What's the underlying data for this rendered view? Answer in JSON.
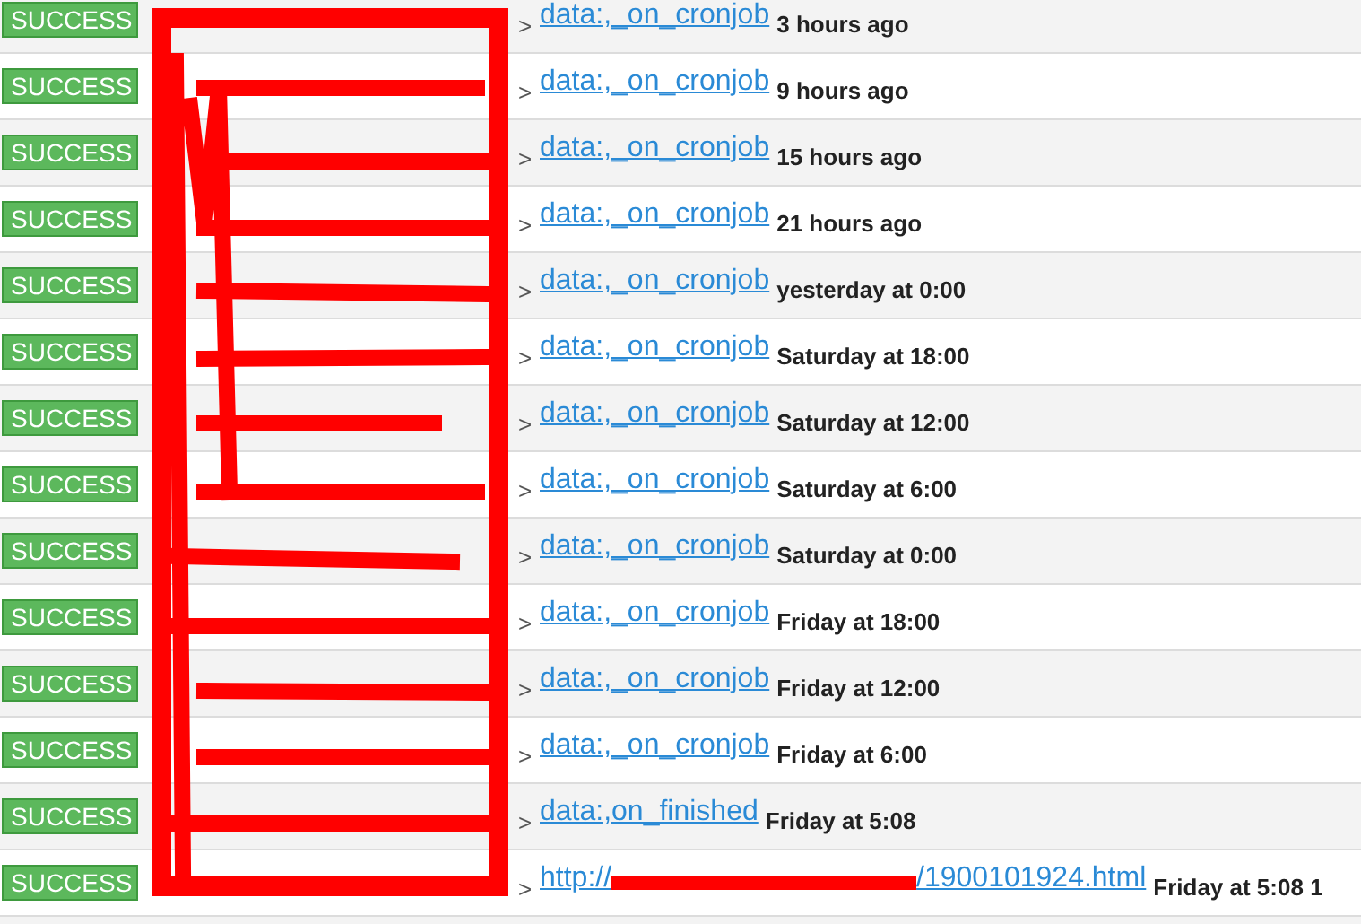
{
  "rows": [
    {
      "status": "SUCCESS",
      "link": {
        "kind": "text",
        "text": "data:,_on_cronjob"
      },
      "time": "3 hours ago"
    },
    {
      "status": "SUCCESS",
      "link": {
        "kind": "text",
        "text": "data:,_on_cronjob"
      },
      "time": "9 hours ago"
    },
    {
      "status": "SUCCESS",
      "link": {
        "kind": "text",
        "text": "data:,_on_cronjob"
      },
      "time": "15 hours ago"
    },
    {
      "status": "SUCCESS",
      "link": {
        "kind": "text",
        "text": "data:,_on_cronjob"
      },
      "time": "21 hours ago"
    },
    {
      "status": "SUCCESS",
      "link": {
        "kind": "text",
        "text": "data:,_on_cronjob"
      },
      "time": "yesterday at 0:00"
    },
    {
      "status": "SUCCESS",
      "link": {
        "kind": "text",
        "text": "data:,_on_cronjob"
      },
      "time": "Saturday at 18:00"
    },
    {
      "status": "SUCCESS",
      "link": {
        "kind": "text",
        "text": "data:,_on_cronjob"
      },
      "time": "Saturday at 12:00"
    },
    {
      "status": "SUCCESS",
      "link": {
        "kind": "text",
        "text": "data:,_on_cronjob"
      },
      "time": "Saturday at 6:00"
    },
    {
      "status": "SUCCESS",
      "link": {
        "kind": "text",
        "text": "data:,_on_cronjob"
      },
      "time": "Saturday at 0:00"
    },
    {
      "status": "SUCCESS",
      "link": {
        "kind": "text",
        "text": "data:,_on_cronjob"
      },
      "time": "Friday at 18:00"
    },
    {
      "status": "SUCCESS",
      "link": {
        "kind": "text",
        "text": "data:,_on_cronjob"
      },
      "time": "Friday at 12:00"
    },
    {
      "status": "SUCCESS",
      "link": {
        "kind": "text",
        "text": "data:,_on_cronjob"
      },
      "time": "Friday at 6:00"
    },
    {
      "status": "SUCCESS",
      "link": {
        "kind": "text",
        "text": "data:,on_finished"
      },
      "time": "Friday at 5:08"
    },
    {
      "status": "SUCCESS",
      "link": {
        "kind": "redacted_url",
        "prefix": "http://",
        "suffix": "/1900101924.html"
      },
      "time": "Friday at 5:08 1"
    }
  ],
  "separator": ">"
}
